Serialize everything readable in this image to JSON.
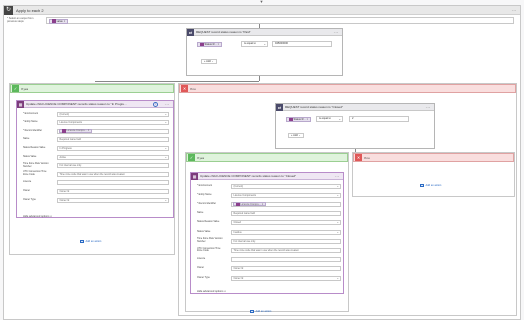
{
  "apply_to_each": {
    "title": "Apply to each 2",
    "dots": "···",
    "selected_label": "* Select an output from previous steps",
    "selected_chip": "value"
  },
  "condition_top": {
    "title": "REQUEST record status reason is \"Paid\"",
    "dots": "···",
    "chip": "Status R...",
    "operator": "is equal to",
    "value": "945000000",
    "add": "Add"
  },
  "yes_left": {
    "label": "If yes",
    "card": {
      "title": "Update child LICENCE COMPONENT records status reason to \"In Progre...",
      "rows": [
        {
          "label": "* Environment",
          "value": "(Current)",
          "chevron": true
        },
        {
          "label": "* Entity Name",
          "value": "Licence Components",
          "chevron": true
        },
        {
          "label": "* Record identifier",
          "value": "Licence Compo...",
          "chip": true
        },
        {
          "label": "Name",
          "value": "Required name field",
          "chevron": false
        },
        {
          "label": "Status Reason Value",
          "value": "In Progress",
          "chevron": true
        },
        {
          "label": "Status Value",
          "value": "Active",
          "chevron": true
        },
        {
          "label": "Time Zone Rule Version Number",
          "value": "For internal use only.",
          "chevron": false
        },
        {
          "label": "UTC Conversion Time Zone Code",
          "value": "Time zone code that was in use when the record was created.",
          "chevron": false
        },
        {
          "label": "Licence",
          "value": "",
          "chevron": false
        },
        {
          "label": "Owner",
          "value": "Owner Id",
          "chevron": false
        },
        {
          "label": "Owner Type",
          "value": "Owner Id",
          "chevron": true
        }
      ],
      "hide_advanced": "Hide advanced options ∧"
    },
    "add_action": "Add an action"
  },
  "no_main": {
    "label": "If no"
  },
  "condition_closed": {
    "title": "REQUEST record status reason is \"Closed\"",
    "dots": "···",
    "chip": "Status R...",
    "operator": "is equal to",
    "value": "2",
    "add": "Add"
  },
  "yes_inner": {
    "label": "If yes",
    "card": {
      "title": "Update child LICENCE COMPONENT records status reason to \"Closed\"",
      "dots": "···",
      "rows": [
        {
          "label": "* Environment",
          "value": "(Current)",
          "chevron": true
        },
        {
          "label": "* Entity Name",
          "value": "Licence Components",
          "chevron": true
        },
        {
          "label": "* Record identifier",
          "value": "Licence Compo...",
          "chip": true
        },
        {
          "label": "Name",
          "value": "Required name field",
          "chevron": false
        },
        {
          "label": "Status Reason Value",
          "value": "Closed",
          "chevron": true
        },
        {
          "label": "Status Value",
          "value": "Inactive",
          "chevron": true
        },
        {
          "label": "Time Zone Rule Version Number",
          "value": "For internal use only.",
          "chevron": false
        },
        {
          "label": "UTC Conversion Time Zone Code",
          "value": "Time zone code that was in use when the record was created.",
          "chevron": false
        },
        {
          "label": "Licence",
          "value": "",
          "chevron": false
        },
        {
          "label": "Owner",
          "value": "Owner Id",
          "chevron": false
        },
        {
          "label": "Owner Type",
          "value": "Owner Id",
          "chevron": true
        }
      ],
      "hide_advanced": "Hide advanced options ∧"
    },
    "add_action": "Add an action"
  },
  "no_inner": {
    "label": "If no",
    "add_action": "Add an action"
  },
  "colors": {
    "yes": "#5cb85c",
    "no": "#e05858",
    "accent": "#2a6ac4",
    "card": "#7c3c7c"
  }
}
